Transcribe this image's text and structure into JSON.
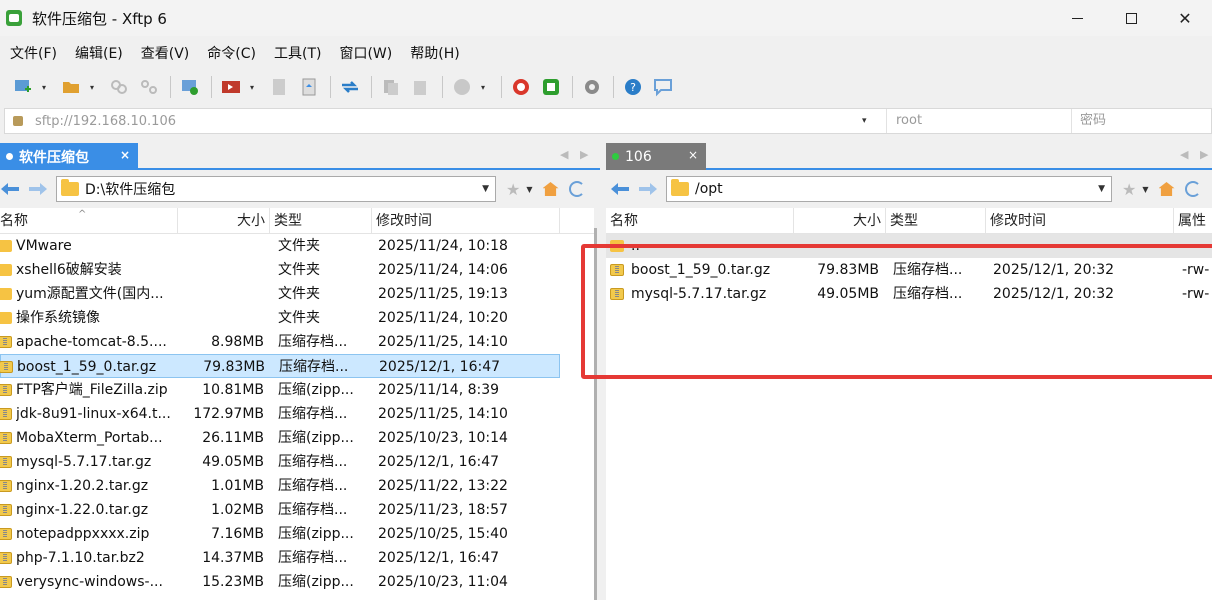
{
  "window": {
    "title": "软件压缩包 - Xftp 6"
  },
  "menu": [
    "文件(F)",
    "编辑(E)",
    "查看(V)",
    "命令(C)",
    "工具(T)",
    "窗口(W)",
    "帮助(H)"
  ],
  "address": {
    "url": "sftp://192.168.10.106",
    "user_placeholder": "root",
    "password_placeholder": "密码"
  },
  "left": {
    "tab_label": "软件压缩包",
    "tab_close": "×",
    "path": "D:\\软件压缩包",
    "columns": {
      "name": "名称",
      "size": "大小",
      "type": "类型",
      "modified": "修改时间"
    },
    "files": [
      {
        "name": "VMware",
        "size": "",
        "type": "文件夹",
        "modified": "2025/11/24, 10:18",
        "icon": "folder"
      },
      {
        "name": "xshell6破解安装",
        "size": "",
        "type": "文件夹",
        "modified": "2025/11/24, 14:06",
        "icon": "folder"
      },
      {
        "name": "yum源配置文件(国内...",
        "size": "",
        "type": "文件夹",
        "modified": "2025/11/25, 19:13",
        "icon": "folder"
      },
      {
        "name": "操作系统镜像",
        "size": "",
        "type": "文件夹",
        "modified": "2025/11/24, 10:20",
        "icon": "folder"
      },
      {
        "name": "apache-tomcat-8.5....",
        "size": "8.98MB",
        "type": "压缩存档...",
        "modified": "2025/11/25, 14:10",
        "icon": "archive"
      },
      {
        "name": "boost_1_59_0.tar.gz",
        "size": "79.83MB",
        "type": "压缩存档...",
        "modified": "2025/12/1, 16:47",
        "icon": "archive",
        "selected": true
      },
      {
        "name": "FTP客户端_FileZilla.zip",
        "size": "10.81MB",
        "type": "压缩(zipp...",
        "modified": "2025/11/14, 8:39",
        "icon": "archive"
      },
      {
        "name": "jdk-8u91-linux-x64.t...",
        "size": "172.97MB",
        "type": "压缩存档...",
        "modified": "2025/11/25, 14:10",
        "icon": "archive"
      },
      {
        "name": "MobaXterm_Portab...",
        "size": "26.11MB",
        "type": "压缩(zipp...",
        "modified": "2025/10/23, 10:14",
        "icon": "archive"
      },
      {
        "name": "mysql-5.7.17.tar.gz",
        "size": "49.05MB",
        "type": "压缩存档...",
        "modified": "2025/12/1, 16:47",
        "icon": "archive"
      },
      {
        "name": "nginx-1.20.2.tar.gz",
        "size": "1.01MB",
        "type": "压缩存档...",
        "modified": "2025/11/22, 13:22",
        "icon": "archive"
      },
      {
        "name": "nginx-1.22.0.tar.gz",
        "size": "1.02MB",
        "type": "压缩存档...",
        "modified": "2025/11/23, 18:57",
        "icon": "archive"
      },
      {
        "name": "notepadppxxxx.zip",
        "size": "7.16MB",
        "type": "压缩(zipp...",
        "modified": "2025/10/25, 15:40",
        "icon": "archive"
      },
      {
        "name": "php-7.1.10.tar.bz2",
        "size": "14.37MB",
        "type": "压缩存档...",
        "modified": "2025/12/1, 16:47",
        "icon": "archive"
      },
      {
        "name": "verysync-windows-...",
        "size": "15.23MB",
        "type": "压缩(zipp...",
        "modified": "2025/10/23, 11:04",
        "icon": "archive"
      }
    ]
  },
  "right": {
    "tab_label": "106",
    "tab_close": "×",
    "path": "/opt",
    "columns": {
      "name": "名称",
      "size": "大小",
      "type": "类型",
      "modified": "修改时间",
      "attr": "属性"
    },
    "files": [
      {
        "name": "..",
        "size": "",
        "type": "",
        "modified": "",
        "attr": "",
        "icon": "folder",
        "parent": true
      },
      {
        "name": "boost_1_59_0.tar.gz",
        "size": "79.83MB",
        "type": "压缩存档...",
        "modified": "2025/12/1, 20:32",
        "attr": "-rw-",
        "icon": "archive"
      },
      {
        "name": "mysql-5.7.17.tar.gz",
        "size": "49.05MB",
        "type": "压缩存档...",
        "modified": "2025/12/1, 20:32",
        "attr": "-rw-",
        "icon": "archive"
      }
    ]
  },
  "colors": {
    "accent": "#3a8ee6",
    "selection": "#cce8ff",
    "highlight_box": "#e53935",
    "connected_dot": "#2ecc40"
  }
}
